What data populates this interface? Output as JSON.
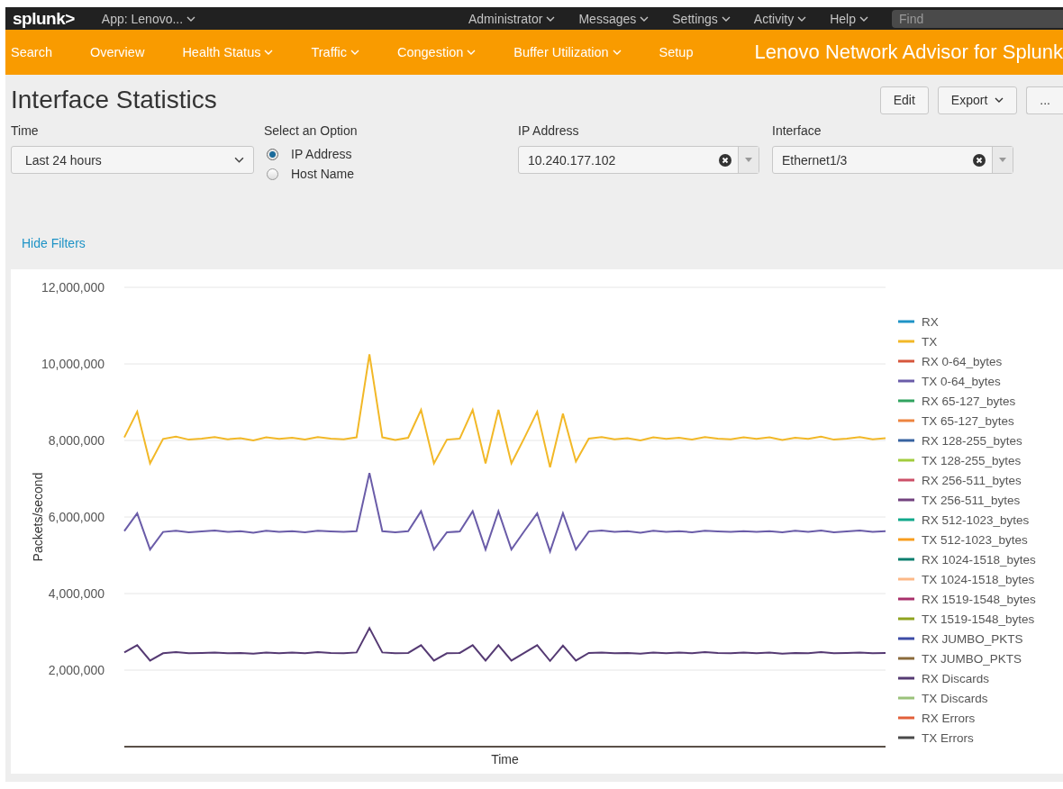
{
  "top_bar": {
    "logo": "splunk>",
    "app_menu": "App: Lenovo...",
    "menus": [
      {
        "label": "Administrator"
      },
      {
        "label": "Messages"
      },
      {
        "label": "Settings"
      },
      {
        "label": "Activity"
      },
      {
        "label": "Help"
      }
    ],
    "search": {
      "placeholder": "Find"
    }
  },
  "nav": {
    "items": [
      {
        "label": "Search",
        "has_menu": false
      },
      {
        "label": "Overview",
        "has_menu": false
      },
      {
        "label": "Health Status",
        "has_menu": true
      },
      {
        "label": "Traffic",
        "has_menu": true
      },
      {
        "label": "Congestion",
        "has_menu": true
      },
      {
        "label": "Buffer Utilization",
        "has_menu": true
      },
      {
        "label": "Setup",
        "has_menu": false
      }
    ],
    "app_title": "Lenovo Network Advisor for Splunk"
  },
  "page": {
    "title": "Interface Statistics",
    "actions": [
      {
        "label": "Edit",
        "has_menu": false
      },
      {
        "label": "Export",
        "has_menu": true
      },
      {
        "label": "...",
        "has_menu": false
      }
    ]
  },
  "filters": {
    "time": {
      "label": "Time",
      "value": "Last 24 hours"
    },
    "option": {
      "label": "Select an Option",
      "options": [
        {
          "label": "IP Address",
          "selected": true
        },
        {
          "label": "Host Name",
          "selected": false
        }
      ]
    },
    "ip_address": {
      "label": "IP Address",
      "value": "10.240.177.102"
    },
    "interface": {
      "label": "Interface",
      "value": "Ethernet1/3"
    },
    "hide_link": "Hide Filters"
  },
  "chart_data": {
    "type": "line",
    "xlabel": "Time",
    "ylabel": "Packets/second",
    "grid": true,
    "legend": true,
    "ylim": [
      0,
      12000000
    ],
    "yticks": [
      {
        "value": 2000000,
        "label": "2,000,000"
      },
      {
        "value": 4000000,
        "label": "4,000,000"
      },
      {
        "value": 6000000,
        "label": "6,000,000"
      },
      {
        "value": 8000000,
        "label": "8,000,000"
      },
      {
        "value": 10000000,
        "label": "10,000,000"
      },
      {
        "value": 12000000,
        "label": "12,000,000"
      }
    ],
    "series": [
      {
        "name": "RX",
        "color": "#1e93c6"
      },
      {
        "name": "TX",
        "color": "#f2b827",
        "values": [
          8080000,
          8750000,
          7400000,
          8040000,
          8100000,
          8020000,
          8050000,
          8090000,
          8030000,
          8060000,
          8000000,
          8080000,
          8040000,
          8070000,
          8020000,
          8090000,
          8050000,
          8030000,
          8080000,
          10250000,
          8080000,
          8010000,
          8070000,
          8800000,
          7400000,
          8020000,
          8050000,
          8800000,
          7400000,
          8800000,
          7400000,
          8060000,
          8750000,
          7300000,
          8700000,
          7450000,
          8050000,
          8090000,
          8030000,
          8060000,
          8000000,
          8080000,
          8040000,
          8070000,
          8020000,
          8090000,
          8050000,
          8030000,
          8080000,
          8040000,
          8080000,
          8010000,
          8070000,
          8040000,
          8100000,
          8020000,
          8050000,
          8090000,
          8030000,
          8060000
        ]
      },
      {
        "name": "RX 0-64_bytes",
        "color": "#d6563c"
      },
      {
        "name": "TX 0-64_bytes",
        "color": "#6a5ca8",
        "values": [
          5630000,
          6100000,
          5150000,
          5610000,
          5640000,
          5600000,
          5620000,
          5650000,
          5610000,
          5630000,
          5590000,
          5640000,
          5610000,
          5630000,
          5600000,
          5640000,
          5620000,
          5610000,
          5630000,
          7150000,
          5630000,
          5600000,
          5630000,
          6150000,
          5150000,
          5600000,
          5620000,
          6150000,
          5150000,
          6150000,
          5150000,
          5630000,
          6100000,
          5100000,
          6100000,
          5150000,
          5620000,
          5650000,
          5610000,
          5630000,
          5590000,
          5640000,
          5610000,
          5630000,
          5600000,
          5640000,
          5620000,
          5610000,
          5630000,
          5610000,
          5630000,
          5600000,
          5640000,
          5610000,
          5650000,
          5600000,
          5620000,
          5650000,
          5610000,
          5630000
        ]
      },
      {
        "name": "RX 65-127_bytes",
        "color": "#31a35f"
      },
      {
        "name": "TX 65-127_bytes",
        "color": "#ed8440"
      },
      {
        "name": "RX 128-255_bytes",
        "color": "#3863a0"
      },
      {
        "name": "TX 128-255_bytes",
        "color": "#a2cc3e"
      },
      {
        "name": "RX 256-511_bytes",
        "color": "#cc5068"
      },
      {
        "name": "TX 256-511_bytes",
        "color": "#73427f"
      },
      {
        "name": "RX 512-1023_bytes",
        "color": "#11a88b"
      },
      {
        "name": "TX 512-1023_bytes",
        "color": "#f89d1e"
      },
      {
        "name": "RX 1024-1518_bytes",
        "color": "#0b7e6e"
      },
      {
        "name": "TX 1024-1518_bytes",
        "color": "#fcb887"
      },
      {
        "name": "RX 1519-1548_bytes",
        "color": "#a8306b"
      },
      {
        "name": "TX 1519-1548_bytes",
        "color": "#8fa31f"
      },
      {
        "name": "RX JUMBO_PKTS",
        "color": "#3c4ba6"
      },
      {
        "name": "TX JUMBO_PKTS",
        "color": "#8a6a3b"
      },
      {
        "name": "RX Discards",
        "color": "#553a73",
        "values": [
          2460000,
          2650000,
          2250000,
          2440000,
          2470000,
          2440000,
          2450000,
          2460000,
          2440000,
          2450000,
          2430000,
          2460000,
          2440000,
          2460000,
          2440000,
          2470000,
          2450000,
          2440000,
          2460000,
          3100000,
          2460000,
          2440000,
          2450000,
          2650000,
          2250000,
          2440000,
          2450000,
          2650000,
          2250000,
          2650000,
          2250000,
          2450000,
          2650000,
          2240000,
          2640000,
          2250000,
          2450000,
          2460000,
          2440000,
          2450000,
          2430000,
          2460000,
          2440000,
          2460000,
          2440000,
          2470000,
          2450000,
          2440000,
          2460000,
          2440000,
          2460000,
          2430000,
          2450000,
          2440000,
          2470000,
          2440000,
          2450000,
          2460000,
          2440000,
          2450000
        ]
      },
      {
        "name": "TX Discards",
        "color": "#9ac27a"
      },
      {
        "name": "RX Errors",
        "color": "#e2603a"
      },
      {
        "name": "TX Errors",
        "color": "#4a4a4a"
      }
    ]
  }
}
